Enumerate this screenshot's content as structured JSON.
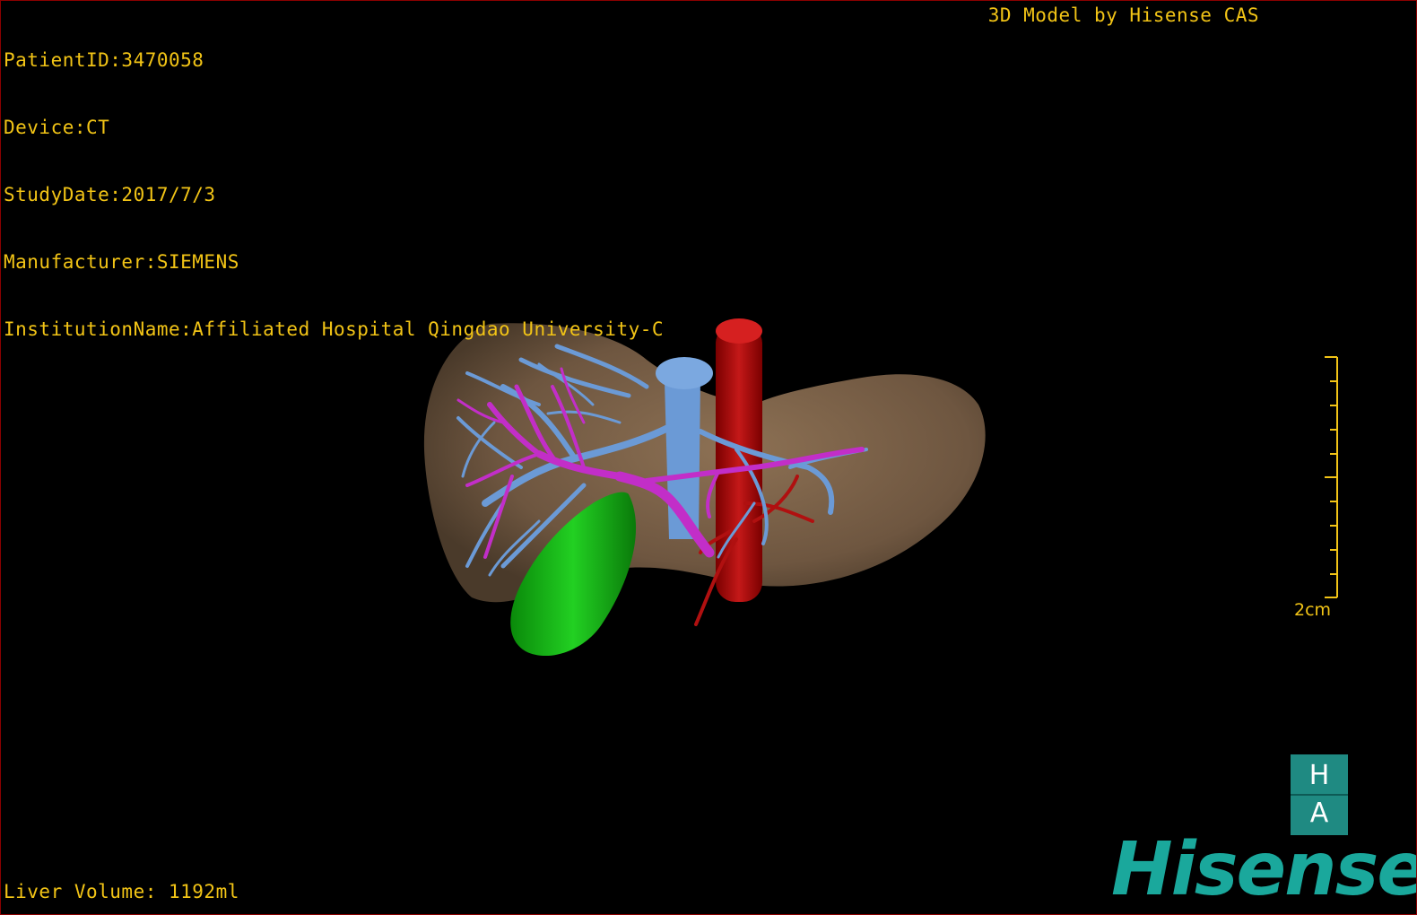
{
  "header": {
    "patient_id": "PatientID:3470058",
    "device": "Device:CT",
    "study_date": "StudyDate:2017/7/3",
    "manufacturer": "Manufacturer:SIEMENS",
    "institution": "InstitutionName:Affiliated Hospital Qingdao University-C"
  },
  "credit": "3D Model by Hisense CAS",
  "footer": {
    "liver_volume": "Liver Volume: 1192ml"
  },
  "scale": {
    "label": "2cm"
  },
  "orientation": {
    "top": "H",
    "bottom": "A"
  },
  "brand": {
    "name": "Hisense"
  },
  "colors": {
    "overlay_text": "#f2c416",
    "liver": "#7a6048",
    "portal_vein": "#6b9ad6",
    "hepatic_vein": "#c22ec8",
    "artery": "#b01010",
    "gallbladder": "#14b814",
    "brand": "#1aa89c"
  }
}
